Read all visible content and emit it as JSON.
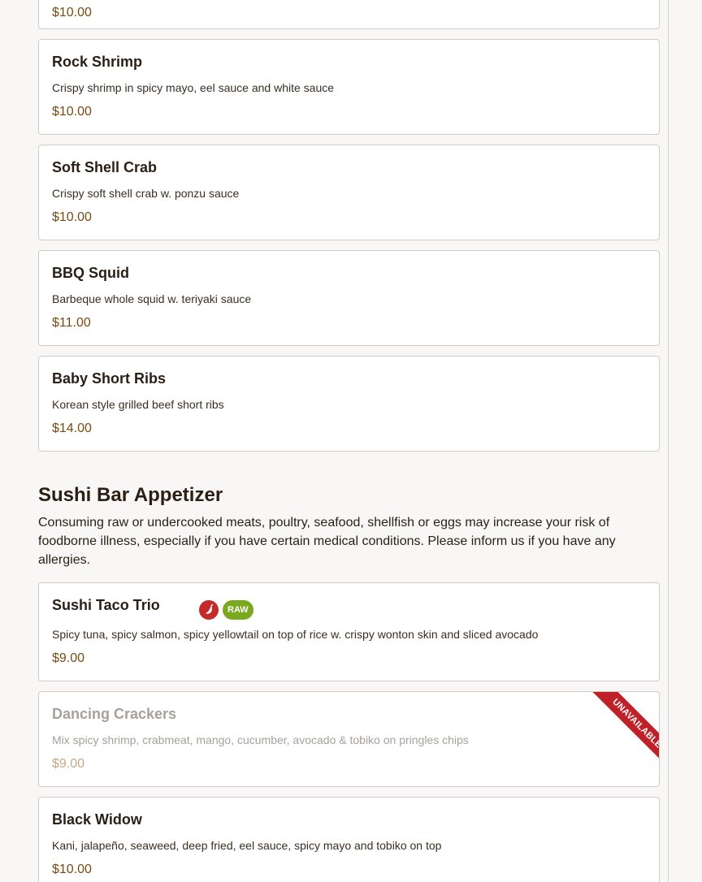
{
  "menu_items_top": [
    {
      "name": "",
      "description": "",
      "price": "$10.00"
    },
    {
      "name": "Rock Shrimp",
      "description": "Crispy shrimp in spicy mayo, eel sauce and white sauce",
      "price": "$10.00"
    },
    {
      "name": "Soft Shell Crab",
      "description": "Crispy soft shell crab w. ponzu sauce",
      "price": "$10.00"
    },
    {
      "name": "BBQ Squid",
      "description": "Barbeque whole squid w. teriyaki sauce",
      "price": "$11.00"
    },
    {
      "name": "Baby Short Ribs",
      "description": "Korean style grilled beef short ribs",
      "price": "$14.00"
    }
  ],
  "section": {
    "title": "Sushi Bar Appetizer",
    "note": "Consuming raw or undercooked meats, poultry, seafood, shellfish or eggs may increase your risk of foodborne illness, especially if you have certain medical conditions. Please inform us if you have any allergies."
  },
  "sushi_items": [
    {
      "name": "Sushi Taco Trio",
      "description": "Spicy tuna, spicy salmon, spicy yellowtail on top of rice w. crispy wonton skin and sliced avocado",
      "price": "$9.00",
      "badges": {
        "spicy_icon": "chili-pepper-icon",
        "raw": "RAW"
      }
    },
    {
      "name": "Dancing Crackers",
      "description": "Mix spicy shrimp, crabmeat, mango, cucumber, avocado & tobiko on pringles chips",
      "price": "$9.00",
      "status": "UNAVAILABLE"
    },
    {
      "name": "Black Widow",
      "description": "Kani, jalapeño, seaweed, deep fried, eel sauce, spicy mayo and tobiko on top",
      "price": "$10.00"
    }
  ],
  "colors": {
    "price": "#7a4a12",
    "spicy_badge": "#c42a2a",
    "raw_badge": "#7aa81e",
    "unavailable_ribbon": "#c02028"
  }
}
